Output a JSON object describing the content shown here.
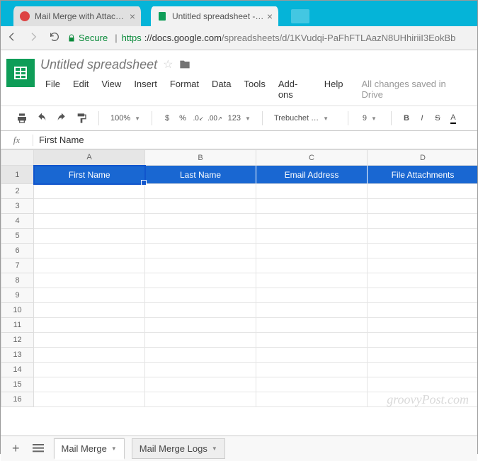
{
  "browser": {
    "tabs": [
      {
        "label": "Mail Merge with Attachm"
      },
      {
        "label": "Untitled spreadsheet - Go"
      }
    ],
    "url": {
      "secure_label": "Secure",
      "scheme": "https",
      "host": "://docs.google.com",
      "path": "/spreadsheets/d/1KVudqi-PaFhFTLAazN8UHhiriiI3EokBb"
    }
  },
  "doc": {
    "title": "Untitled spreadsheet",
    "menus": [
      "File",
      "Edit",
      "View",
      "Insert",
      "Format",
      "Data",
      "Tools",
      "Add-ons",
      "Help"
    ],
    "saved_status": "All changes saved in Drive"
  },
  "toolbar": {
    "zoom": "100%",
    "currency": "$",
    "percent": "%",
    "dec_less": ".0",
    "dec_more": ".00",
    "more_formats": "123",
    "font": "Trebuchet …",
    "font_size": "9",
    "bold": "B",
    "italic": "I",
    "strike": "S",
    "text_color": "A"
  },
  "formula_bar": {
    "fx": "fx",
    "value": "First Name"
  },
  "grid": {
    "columns": [
      "A",
      "B",
      "C",
      "D"
    ],
    "header_row": [
      "First Name",
      "Last Name",
      "Email Address",
      "File Attachments"
    ],
    "rows": 16,
    "active_cell": {
      "row": 1,
      "col": 0
    }
  },
  "sheet_tabs": {
    "add": "+",
    "tabs": [
      {
        "label": "Mail Merge",
        "active": true
      },
      {
        "label": "Mail Merge Logs",
        "active": false
      }
    ]
  },
  "watermark": "groovyPost.com"
}
